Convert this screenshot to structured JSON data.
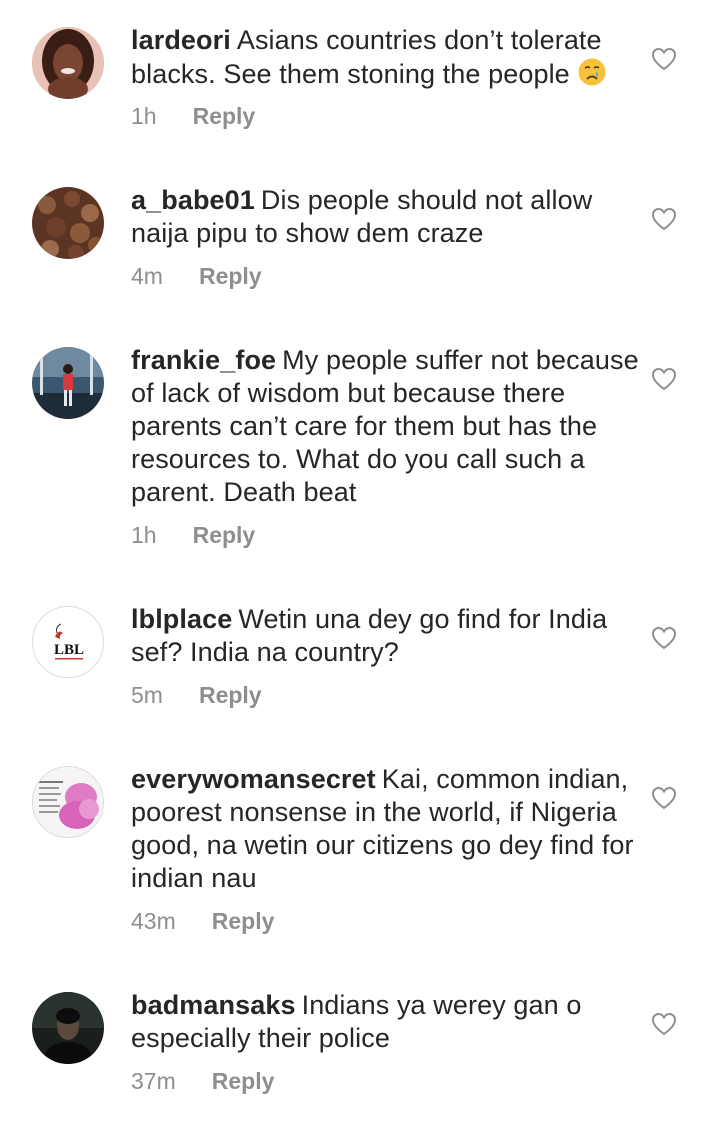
{
  "comments": [
    {
      "username": "lardeori",
      "text": "Asians countries don’t tolerate blacks. See them stoning the people",
      "emoji": "crying-face",
      "time": "1h",
      "reply_label": "Reply"
    },
    {
      "username": "a_babe01",
      "text": "Dis people should not allow naija pipu to show dem craze",
      "time": "4m",
      "reply_label": "Reply"
    },
    {
      "username": "frankie_foe",
      "text": "My people suffer not because of lack of wisdom but because there parents can’t care for them but has the resources to. What do you call such a parent. Death beat",
      "time": "1h",
      "reply_label": "Reply"
    },
    {
      "username": "lblplace",
      "text": "Wetin una dey go find for India sef? India na country?",
      "time": "5m",
      "reply_label": "Reply",
      "avatar_logo_text": "LBL"
    },
    {
      "username": "everywomansecret",
      "text": "Kai, common indian, poorest nonsense in the world, if Nigeria good, na wetin our citizens go dey find for indian nau",
      "time": "43m",
      "reply_label": "Reply"
    },
    {
      "username": "badmansaks",
      "text": "Indians ya werey gan o especially their police",
      "time": "37m",
      "reply_label": "Reply"
    }
  ],
  "icons": {
    "like": "heart-outline-icon",
    "emoji": "crying-face-emoji"
  },
  "colors": {
    "text": "#262626",
    "meta": "#8e8e8e",
    "heart_stroke": "#8e8e8e"
  }
}
